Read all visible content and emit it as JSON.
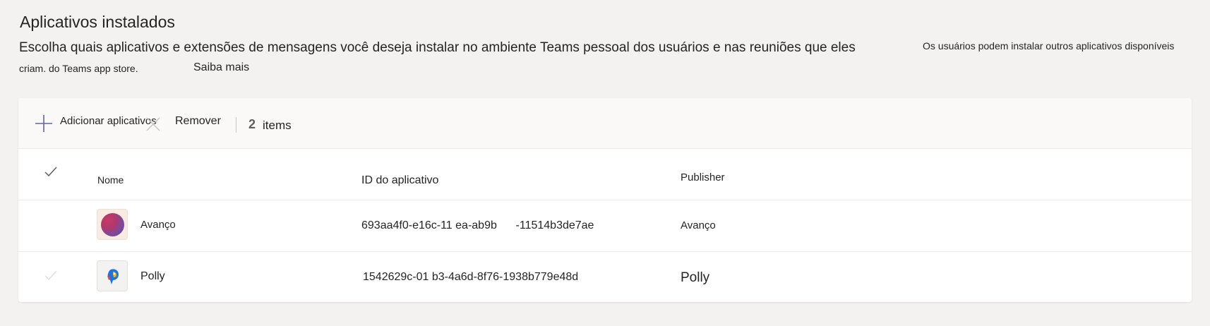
{
  "header": {
    "title": "Aplicativos instalados",
    "description_line1": "Escolha quais aplicativos e extensões de mensagens você deseja instalar no ambiente Teams pessoal dos usuários e nas reuniões que eles",
    "description_line2": "criam. do Teams app store.",
    "learn_more_label": "Saiba mais",
    "side_note": "Os usuários podem instalar outros aplicativos disponíveis"
  },
  "toolbar": {
    "add_label": "Adicionar aplicativos",
    "remove_label": "Remover",
    "item_count": "2",
    "item_count_label": "items"
  },
  "table": {
    "columns": {
      "name": "Nome",
      "app_id": "ID do aplicativo",
      "publisher": "Publisher"
    },
    "rows": [
      {
        "name": "Avanço",
        "app_id": "693aa4f0-e16c-11 ea-ab9b      -11514b3de7ae",
        "publisher": "Avanço",
        "icon": "avanco-app-icon"
      },
      {
        "name": "Polly",
        "app_id": "1542629c-01 b3-4a6d-8f76-1938b779e48d",
        "publisher": "Polly",
        "icon": "polly-app-icon"
      }
    ]
  },
  "colors": {
    "page_background": "#f3f2f1",
    "card_background": "#ffffff",
    "toolbar_background": "#faf9f8",
    "add_icon": "#6264a7",
    "text": "#242424"
  }
}
